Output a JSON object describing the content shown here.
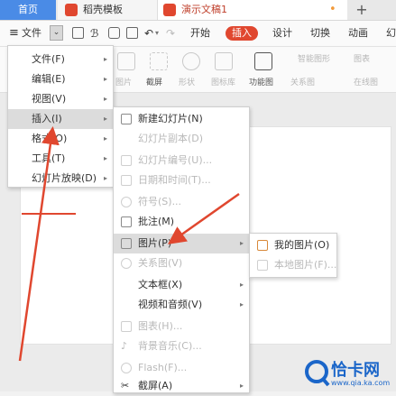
{
  "tabs": {
    "home": "首页",
    "template": "稻壳模板",
    "doc": "演示文稿1",
    "new": "+"
  },
  "toolbar": {
    "menu_file": "文件",
    "start": "开始",
    "insert": "插入",
    "design": "设计",
    "switch": "切换",
    "animation": "动画",
    "more": "幻"
  },
  "ribbon": {
    "picture": "图片",
    "screenshot": "截屏",
    "shape": "形状",
    "iconlib": "图标库",
    "funcchart": "功能图",
    "relation": "关系图",
    "smartart": "智能图形",
    "chart": "图表",
    "online_chart": "在线图"
  },
  "main_menu": [
    {
      "label": "文件(F)",
      "arrow": true
    },
    {
      "label": "编辑(E)",
      "arrow": true
    },
    {
      "label": "视图(V)",
      "arrow": true
    },
    {
      "label": "插入(I)",
      "arrow": true,
      "active": true
    },
    {
      "label": "格式(O)",
      "arrow": true
    },
    {
      "label": "工具(T)",
      "arrow": true
    },
    {
      "label": "幻灯片放映(D)",
      "arrow": true
    }
  ],
  "insert_menu": [
    {
      "label": "新建幻灯片(N)",
      "disabled": false,
      "icon": "new-slide-icon"
    },
    {
      "label": "幻灯片副本(D)",
      "disabled": true,
      "icon": ""
    },
    {
      "label": "幻灯片编号(U)...",
      "disabled": true,
      "icon": "slide-number-icon"
    },
    {
      "label": "日期和时间(T)...",
      "disabled": true,
      "icon": "calendar-icon"
    },
    {
      "label": "符号(S)...",
      "disabled": true,
      "icon": "omega-icon"
    },
    {
      "label": "批注(M)",
      "disabled": false,
      "icon": "comment-icon"
    },
    {
      "label": "图片(P)",
      "disabled": false,
      "icon": "picture-icon",
      "arrow": true,
      "active": true
    },
    {
      "label": "关系图(V)",
      "disabled": true,
      "icon": "relation-icon"
    },
    {
      "label": "文本框(X)",
      "disabled": false,
      "icon": "",
      "arrow": true
    },
    {
      "label": "视频和音频(V)",
      "disabled": false,
      "icon": "",
      "arrow": true
    },
    {
      "label": "图表(H)...",
      "disabled": true,
      "icon": "chart-icon"
    },
    {
      "label": "背景音乐(C)...",
      "disabled": true,
      "icon": "music-icon"
    },
    {
      "label": "Flash(F)...",
      "disabled": true,
      "icon": "flash-icon"
    },
    {
      "label": "截屏(A)",
      "disabled": false,
      "icon": "scissors-icon",
      "arrow": true
    }
  ],
  "picture_menu": [
    {
      "label": "我的图片(O)",
      "disabled": false
    },
    {
      "label": "本地图片(F)...",
      "disabled": true
    }
  ],
  "watermark": {
    "text": "恰卡网",
    "url": "www.qia.ka.com"
  },
  "colors": {
    "accent": "#e0472f",
    "tab_blue": "#4a8be6",
    "watermark_blue": "#1b66c9"
  }
}
